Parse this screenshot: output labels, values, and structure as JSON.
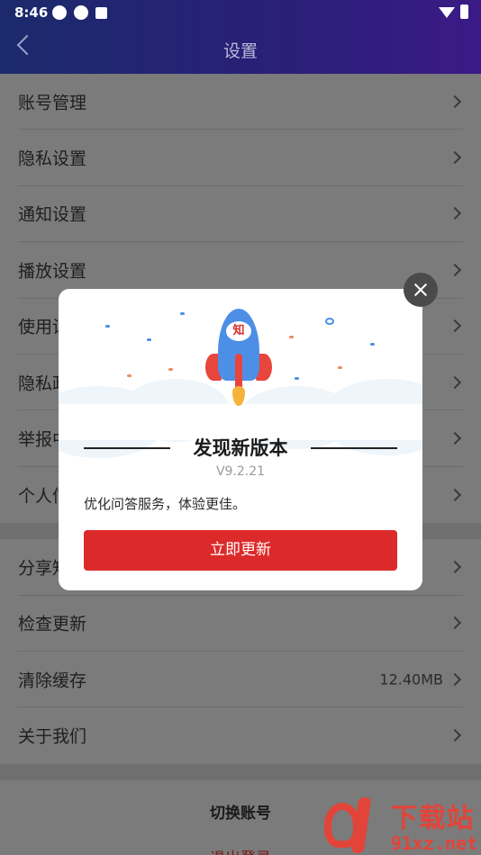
{
  "status_bar": {
    "time": "8:46"
  },
  "header": {
    "title": "设置"
  },
  "groups": [
    {
      "items": [
        {
          "label": "账号管理"
        },
        {
          "label": "隐私设置"
        },
        {
          "label": "通知设置"
        },
        {
          "label": "播放设置"
        },
        {
          "label": "使用设置"
        },
        {
          "label": "隐私政策"
        },
        {
          "label": "举报中心"
        },
        {
          "label": "个人信息"
        }
      ]
    },
    {
      "items": [
        {
          "label": "分享知乎"
        },
        {
          "label": "检查更新"
        },
        {
          "label": "清除缓存",
          "value": "12.40MB"
        },
        {
          "label": "关于我们"
        }
      ]
    }
  ],
  "bottom": {
    "switch_account": "切换账号",
    "logout": "退出登录"
  },
  "dialog": {
    "rocket_char": "知",
    "title": "发现新版本",
    "version": "V9.2.21",
    "description": "优化问答服务，体验更佳。",
    "update_button": "立即更新"
  },
  "watermark": {
    "top": "下载站",
    "bottom": "91xz.net"
  },
  "colors": {
    "accent": "#dc2a2b",
    "header_start": "#1b2a6b",
    "header_end": "#3b1a86"
  }
}
